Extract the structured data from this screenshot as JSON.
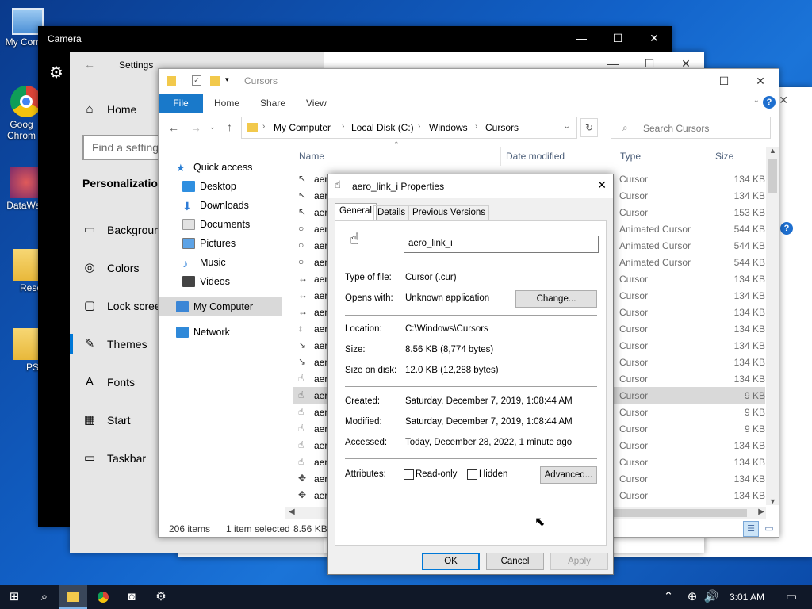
{
  "desktop": {
    "icons": [
      {
        "label": "My Com"
      },
      {
        "label": "Goog Chrom"
      },
      {
        "label": "DataWag"
      },
      {
        "label": "Rese"
      },
      {
        "label": "PS"
      }
    ]
  },
  "camera": {
    "title": "Camera"
  },
  "settings": {
    "title": "Settings",
    "home": "Home",
    "search_placeholder": "Find a setting",
    "section": "Personalization",
    "items": [
      {
        "label": "Background",
        "icon": "picture-icon"
      },
      {
        "label": "Colors",
        "icon": "palette-icon"
      },
      {
        "label": "Lock screen",
        "icon": "monitor-icon"
      },
      {
        "label": "Themes",
        "icon": "brush-icon"
      },
      {
        "label": "Fonts",
        "icon": "font-icon"
      },
      {
        "label": "Start",
        "icon": "start-icon"
      },
      {
        "label": "Taskbar",
        "icon": "taskbar-icon"
      }
    ]
  },
  "explorer": {
    "title": "Cursors",
    "ribbon": {
      "file": "File",
      "home": "Home",
      "share": "Share",
      "view": "View"
    },
    "address": [
      "My Computer",
      "Local Disk (C:)",
      "Windows",
      "Cursors"
    ],
    "search_placeholder": "Search Cursors",
    "columns": {
      "name": "Name",
      "date": "Date modified",
      "type": "Type",
      "size": "Size"
    },
    "nav": [
      {
        "label": "Quick access",
        "color": "#2a7fd4"
      },
      {
        "label": "Desktop",
        "color": "#2f8fe0"
      },
      {
        "label": "Downloads",
        "color": "#2e7cd6"
      },
      {
        "label": "Documents",
        "color": "#e2e2e2"
      },
      {
        "label": "Pictures",
        "color": "#5da3e6"
      },
      {
        "label": "Music",
        "color": "#2d7fd8"
      },
      {
        "label": "Videos",
        "color": "#444444"
      },
      {
        "label": "My Computer",
        "color": "#3b86d6"
      },
      {
        "label": "Network",
        "color": "#2f89d9"
      }
    ],
    "rows": [
      {
        "name": "aer",
        "type": "Cursor",
        "size": "134 KB"
      },
      {
        "name": "aer",
        "type": "Cursor",
        "size": "134 KB"
      },
      {
        "name": "aer",
        "type": "Cursor",
        "size": "153 KB"
      },
      {
        "name": "aer",
        "type": "Animated Cursor",
        "size": "544 KB"
      },
      {
        "name": "aer",
        "type": "Animated Cursor",
        "size": "544 KB"
      },
      {
        "name": "aer",
        "type": "Animated Cursor",
        "size": "544 KB"
      },
      {
        "name": "aer",
        "type": "Cursor",
        "size": "134 KB"
      },
      {
        "name": "aer",
        "type": "Cursor",
        "size": "134 KB"
      },
      {
        "name": "aer",
        "type": "Cursor",
        "size": "134 KB"
      },
      {
        "name": "aer",
        "type": "Cursor",
        "size": "134 KB"
      },
      {
        "name": "aer",
        "type": "Cursor",
        "size": "134 KB"
      },
      {
        "name": "aer",
        "type": "Cursor",
        "size": "134 KB"
      },
      {
        "name": "aer",
        "type": "Cursor",
        "size": "134 KB"
      },
      {
        "name": "aer",
        "type": "Cursor",
        "size": "9 KB"
      },
      {
        "name": "aer",
        "type": "Cursor",
        "size": "9 KB"
      },
      {
        "name": "aer",
        "type": "Cursor",
        "size": "9 KB"
      },
      {
        "name": "aer",
        "type": "Cursor",
        "size": "134 KB"
      },
      {
        "name": "aer",
        "type": "Cursor",
        "size": "134 KB"
      },
      {
        "name": "aer",
        "type": "Cursor",
        "size": "134 KB"
      },
      {
        "name": "aer",
        "type": "Cursor",
        "size": "134 KB"
      }
    ],
    "status": {
      "count": "206 items",
      "selected": "1 item selected",
      "size": "8.56 KB"
    }
  },
  "dialog": {
    "title": "aero_link_i Properties",
    "tabs": [
      "General",
      "Details",
      "Previous Versions"
    ],
    "filename": "aero_link_i",
    "type_label": "Type of file:",
    "type_value": "Cursor (.cur)",
    "opens_label": "Opens with:",
    "opens_value": "Unknown application",
    "change": "Change...",
    "location_label": "Location:",
    "location_value": "C:\\Windows\\Cursors",
    "size_label": "Size:",
    "size_value": "8.56 KB (8,774 bytes)",
    "disk_label": "Size on disk:",
    "disk_value": "12.0 KB (12,288 bytes)",
    "created_label": "Created:",
    "created_value": "Saturday, December 7, 2019, 1:08:44 AM",
    "modified_label": "Modified:",
    "modified_value": "Saturday, December 7, 2019, 1:08:44 AM",
    "accessed_label": "Accessed:",
    "accessed_value": "Today, December 28, 2022, 1 minute ago",
    "attributes_label": "Attributes:",
    "readonly": "Read-only",
    "hidden": "Hidden",
    "advanced": "Advanced...",
    "ok": "OK",
    "cancel": "Cancel",
    "apply": "Apply"
  },
  "taskbar": {
    "time": "3:01 AM"
  }
}
